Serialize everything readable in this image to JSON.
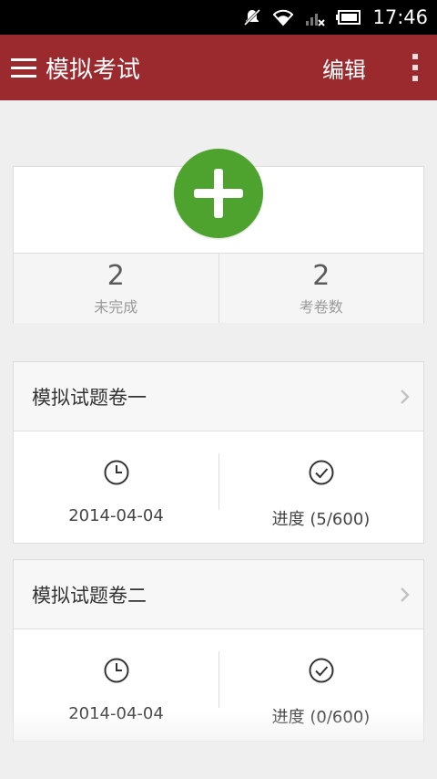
{
  "status_bar": {
    "time": "17:46",
    "icons": [
      "muted-icon",
      "wifi-icon",
      "signal-icon",
      "battery-icon"
    ]
  },
  "app_bar": {
    "title": "模拟考试",
    "edit_label": "编辑",
    "bg_color": "#9b2a2e"
  },
  "summary": {
    "add_button_color": "#4ea32f",
    "stats": [
      {
        "value": "2",
        "label": "未完成"
      },
      {
        "value": "2",
        "label": "考卷数"
      }
    ]
  },
  "exams": [
    {
      "name": "模拟试题卷一",
      "date": "2014-04-04",
      "progress": "进度 (5/600)"
    },
    {
      "name": "模拟试题卷二",
      "date": "2014-04-04",
      "progress": "进度 (0/600)"
    }
  ]
}
